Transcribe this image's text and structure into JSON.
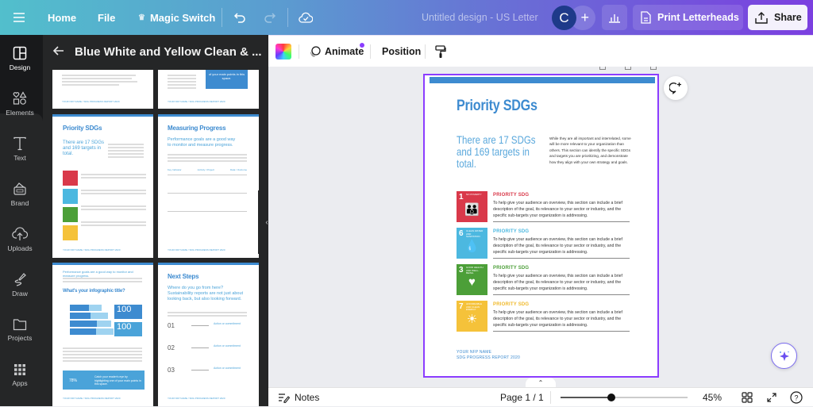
{
  "topbar": {
    "home": "Home",
    "file": "File",
    "magic_switch": "Magic Switch",
    "title": "Untitled design - US Letter",
    "avatar_initial": "C",
    "print_label": "Print Letterheads",
    "share_label": "Share",
    "icons": {
      "menu": "hamburger-icon",
      "crown": "crown-icon",
      "undo": "undo-icon",
      "redo": "redo-icon",
      "cloud": "cloud-saved-icon",
      "stats": "bar-chart-icon",
      "print": "document-icon",
      "share": "upload-icon"
    }
  },
  "rail": {
    "items": [
      {
        "label": "Design",
        "icon": "layout-icon",
        "active": true
      },
      {
        "label": "Elements",
        "icon": "shapes-icon"
      },
      {
        "label": "Text",
        "icon": "text-icon"
      },
      {
        "label": "Brand",
        "icon": "brand-icon"
      },
      {
        "label": "Uploads",
        "icon": "cloud-upload-icon"
      },
      {
        "label": "Draw",
        "icon": "pen-icon"
      },
      {
        "label": "Projects",
        "icon": "folder-icon"
      },
      {
        "label": "Apps",
        "icon": "apps-grid-icon"
      }
    ]
  },
  "panel": {
    "title": "Blue White and Yellow Clean & ...",
    "thumbs": [
      {
        "title": "",
        "footer": "YOUR NFP NAME / SDG PROGRESS REPORT 2020"
      },
      {
        "title": "",
        "highlight": "of your main points in this space.",
        "footer": "YOUR NFP NAME / SDG PROGRESS REPORT 2020"
      },
      {
        "title": "Priority SDGs",
        "subtitle": "There are 17 SDGs and 169 targets in total.",
        "footer": "YOUR NFP NAME / SDG PROGRESS REPORT 2020"
      },
      {
        "title": "Measuring Progress",
        "subtitle": "Performance goals are a good way to monitor and measure progress.",
        "columns": [
          "Key Indicator",
          "Activity / Project",
          "Data / Outcome"
        ],
        "footer": "YOUR NFP NAME / SDG PROGRESS REPORT 2020"
      },
      {
        "title": "What's your infographic title?",
        "subtitle": "Performance goals are a good way to monitor and measure progress.",
        "stat1": "100",
        "stat2": "100",
        "gauge": "78%",
        "callout": "Catch your reader's eye by highlighting one of your main points in this space.",
        "footer": "YOUR NFP NAME / SDG PROGRESS REPORT 2020"
      },
      {
        "title": "Next Steps",
        "subtitle": "Where do you go from here? Sustainability reports are not just about looking back, but also looking forward.",
        "steps": [
          "01",
          "02",
          "03"
        ],
        "step_label": "Action or commitment",
        "footer": "YOUR NFP NAME / SDG PROGRESS REPORT 2020"
      }
    ]
  },
  "context_toolbar": {
    "animate": "Animate",
    "position": "Position",
    "icons": {
      "color": "color-swatch-icon",
      "animate": "animate-icon",
      "paint": "paint-roller-icon"
    }
  },
  "page": {
    "title": "Priority SDGs",
    "big_text": "There are 17 SDGs and 169 targets in total.",
    "paragraph": "While they are all important and interrelated, some will be more relevant to your organization than others. This section can identify the specific SDGs and targets you are prioritizing, and demonstrate how they align with your own strategy and goals.",
    "sdgs": [
      {
        "num": "1",
        "label": "NO POVERTY",
        "color": "#d9394a",
        "heading": "PRIORITY SDG",
        "heading_color": "#d9394a",
        "icon": "people-icon",
        "text": "To help give your audience an overview, this section can include a brief description of the goal, its relevance to your sector or industry, and the specific sub-targets your organization is addressing."
      },
      {
        "num": "6",
        "label": "CLEAN WATER AND SANITATION",
        "color": "#4cb8e0",
        "heading": "PRIORITY SDG",
        "heading_color": "#4cb8e0",
        "icon": "water-drop-icon",
        "text": "To help give your audience an overview, this section can include a brief description of the goal, its relevance to your sector or industry, and the specific sub-targets your organization is addressing."
      },
      {
        "num": "3",
        "label": "GOOD HEALTH AND WELL-BEING",
        "color": "#4c9f38",
        "heading": "PRIORITY SDG",
        "heading_color": "#4c9f38",
        "icon": "heartbeat-icon",
        "text": "To help give your audience an overview, this section can include a brief description of the goal, its relevance to your sector or industry, and the specific sub-targets your organization is addressing."
      },
      {
        "num": "7",
        "label": "AFFORDABLE AND CLEAN ENERGY",
        "color": "#f5c23a",
        "heading": "PRIORITY SDG",
        "heading_color": "#f0b92a",
        "icon": "sun-icon",
        "text": "To help give your audience an overview, this section can include a brief description of the goal, its relevance to your sector or industry, and the specific sub-targets your organization is addressing."
      }
    ],
    "footer_line1": "YOUR NFP NAME",
    "footer_line2": "SDG PROGRESS REPORT 2020"
  },
  "bottom": {
    "notes": "Notes",
    "page_indicator": "Page 1 / 1",
    "zoom": "45%",
    "zoom_fraction": 0.4
  },
  "colors": {
    "accent": "#8b3dff",
    "brand_blue": "#3d8bd0"
  }
}
